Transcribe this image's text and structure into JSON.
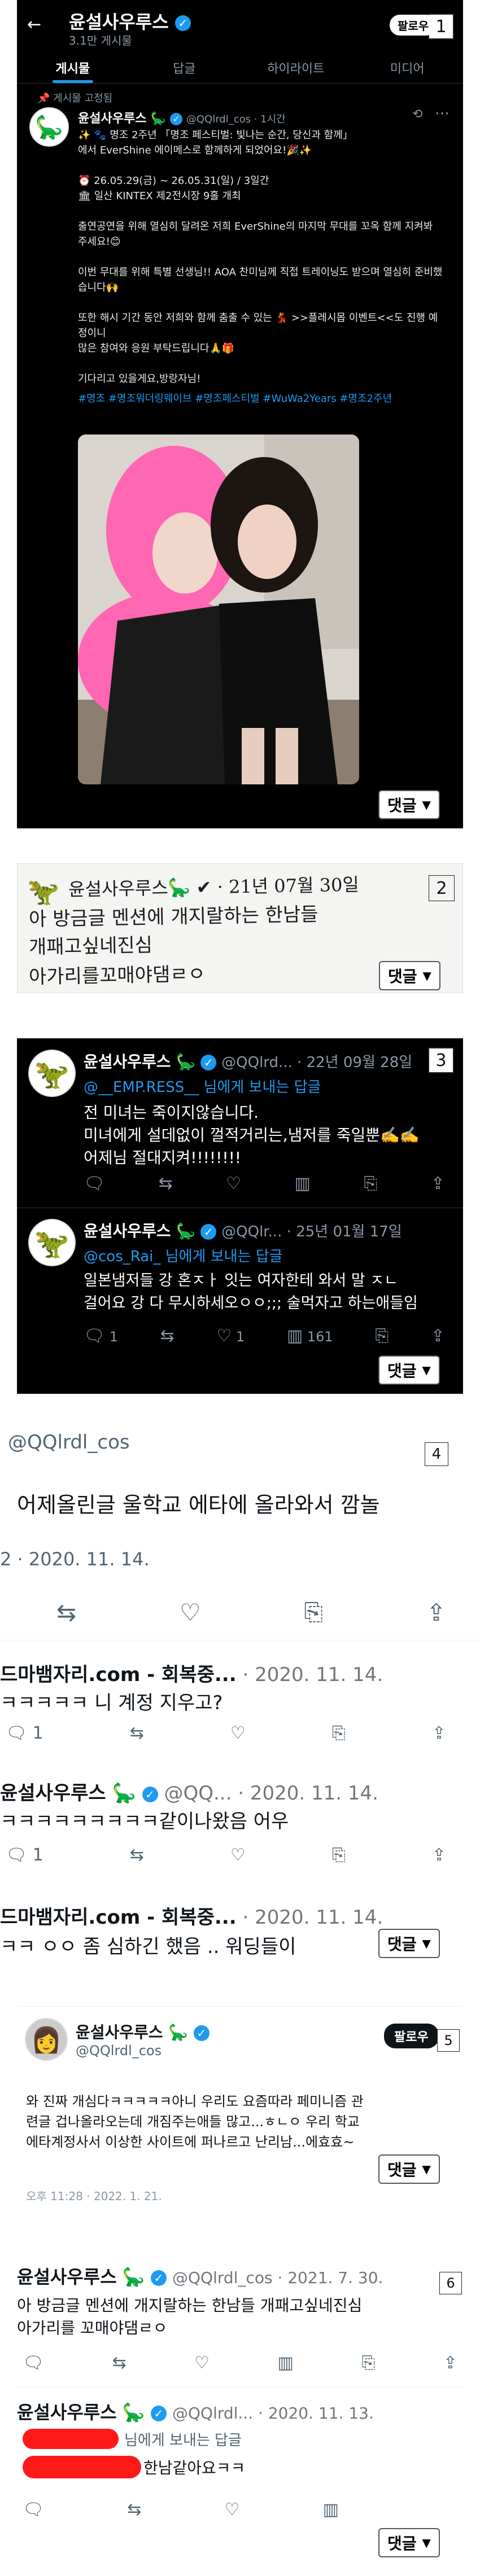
{
  "p1": {
    "badge": "1",
    "header_name": "윤설사우루스",
    "header_count": "3.1만 게시물",
    "follow_label": "팔로우",
    "tabs": [
      "게시물",
      "답글",
      "하이라이트",
      "미디어"
    ],
    "pinned_label": "게시물 고정됨",
    "author": "윤설사우루스",
    "handle": "@QQlrdl_cos · 1시간",
    "body_lines": [
      "✨ 🐾 명조 2주년 「명조 페스티벌: 빛나는 순간, 당신과 함께」",
      "에서 EverShine 에이메스로 함께하게 되었어요!🎉✨",
      "",
      "⏰ 26.05.29(금) ~ 26.05.31(일) / 3일간",
      "🏛 일산 KINTEX 제2전시장 9홀 개최",
      "",
      "출연공연을 위해 열심히 달려온 저희 EverShine의 마지막 무대를 꼬옥 함께 지켜봐 주세요!😊",
      "",
      "이번 무대를 위해 특별 선생님!! AOA 찬미님께 직접 트레이닝도 받으며 열심히 준비했습니다🙌",
      "",
      "또한 해시 기간 동안 저희와 함께 춤출 수 있는 💃 >>플레시몹 이벤트<<도 진행 예정이니",
      "많은 참여와 응원 부탁드립니다🙏🎁",
      "",
      "기다리고 있을게요,방랑자님!"
    ],
    "hashtags": "#명조 #명조워더링웨이브 #명조페스티벌 #WuWa2Years #명조2주년",
    "reply": "댓글"
  },
  "p2": {
    "badge": "2",
    "line1": "윤설사우루스🦕 ✔ · 21년 07월 30일",
    "line2": "아 방금글 멘션에 개지랄하는 한남들",
    "line3": "개패고싶네진심",
    "line4": "아가리를꼬매야댐ㄹㅇ",
    "reply": "댓글"
  },
  "p3": {
    "badge": "3",
    "t1_name": "윤설사우루스",
    "t1_meta": "@QQlrd... · 22년 09월 28일",
    "t1_reply_to": "@__EMP.RESS__ 님에게 보내는 답글",
    "t1_lines": [
      "전 미녀는 죽이지않습니다.",
      "미녀에게 설데없이 껄적거리는,냄저를 죽일뿐✍️✍️",
      "어제님 절대지켜!!!!!!!!"
    ],
    "t2_name": "윤설사우루스",
    "t2_meta": "@QQlr... · 25년 01월 17일",
    "t2_reply_to": "@cos_Rai_ 님에게 보내는 답글",
    "t2_lines": [
      "일본냄저들 강 혼ㅈㅏ 잇는 여자한테 와서 말 ㅈㄴ",
      "걸어요 강 다 무시하세오ㅇㅇ;;; 술먹자고 하는애들임"
    ],
    "t2_counts": [
      "1",
      "",
      "1",
      "161",
      ""
    ],
    "reply": "댓글"
  },
  "p4": {
    "badge": "4",
    "handle": "@QQlrdl_cos",
    "body": "어제올린글 울학교 에타에 올라와서 깜놀",
    "date": "2 · 2020. 11. 14.",
    "r1_name": "드마뱀자리.com - 회복중...",
    "r1_date": "· 2020. 11. 14.",
    "r1_text": "ㅋㅋㅋㅋㅋ 니 계정 지우고?",
    "r1_count": "1",
    "r2_name": "윤설사우루스",
    "r2_meta": "@QQ... · 2020. 11. 14.",
    "r2_text": "ㅋㅋㅋㅋㅋㅋㅋㅋㅋ같이나왔음 어우",
    "r2_count": "1",
    "r3_name": "드마뱀자리.com - 회복중...",
    "r3_date": "· 2020. 11. 14.",
    "r3_text": "ㅋㅋ ㅇㅇ 좀 심하긴 했음 .. 워딩들이",
    "reply": "댓글"
  },
  "p5": {
    "badge": "5",
    "name": "윤설사우루스",
    "handle": "@QQlrdl_cos",
    "follow": "팔로우",
    "lines": [
      "와 진짜 개심다ㅋㅋㅋㅋㅋ아니 우리도 요즘따라 페미니즘 관",
      "련글 겁나올라오는데 개짐주는애들 많고...ㅎㄴㅇ 우리 학교",
      "에타계정사서 이상한 사이트에 퍼나르고 난리남...에효효~"
    ],
    "date": "오후 11:28 · 2022. 1. 21.",
    "reply": "댓글"
  },
  "p6": {
    "badge": "6",
    "t1_name": "윤설사우루스",
    "t1_meta": "@QQlrdl_cos · 2021. 7. 30.",
    "t1_line1": "아 방금글 멘션에 개지랄하는 한남들 개패고싶네진심",
    "t1_line2": "아가리를 꼬매야댐ㄹㅇ",
    "t2_name": "윤설사우루스",
    "t2_meta": "@QQlrdl... · 2020. 11. 13.",
    "t2_reply_to": "님에게 보내는 답글",
    "t2_text": "한남같아요ㅋㅋ",
    "reply": "댓글"
  }
}
